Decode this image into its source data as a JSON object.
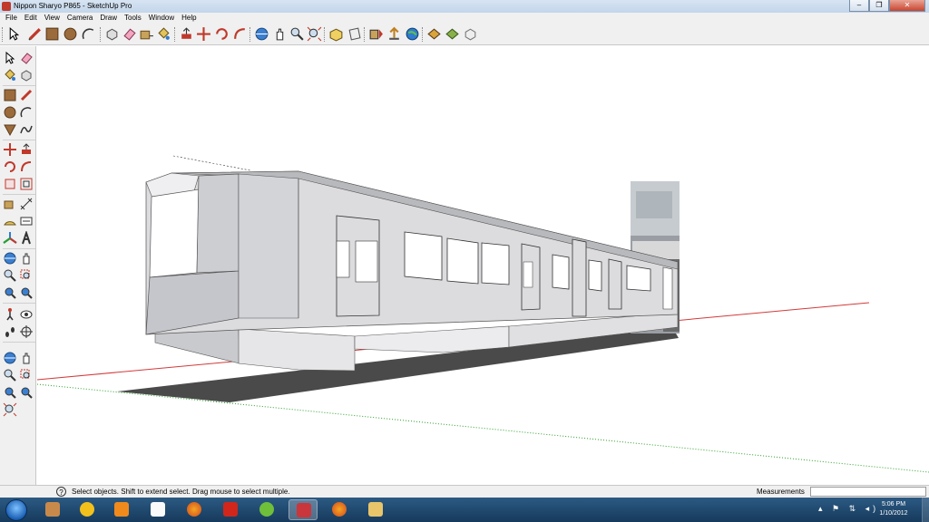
{
  "window": {
    "title": "Nippon Sharyo P865 - SketchUp Pro",
    "minimize_glyph": "–",
    "maximize_glyph": "❐",
    "close_glyph": "✕"
  },
  "menu": [
    "File",
    "Edit",
    "View",
    "Camera",
    "Draw",
    "Tools",
    "Window",
    "Help"
  ],
  "toolbar_icons": [
    "select-icon",
    "pencil-icon",
    "rectangle-icon",
    "circle-icon",
    "arc-icon",
    "make-component-icon",
    "eraser-icon",
    "paint-bucket-icon",
    "push-pull-icon",
    "move-icon",
    "rotate-icon",
    "follow-me-icon",
    "orbit-icon",
    "pan-icon",
    "zoom-icon",
    "zoom-extents-icon",
    "standard-views-icon",
    "section-plane-icon",
    "get-models-icon",
    "share-model-icon",
    "google-earth-icon",
    "component-icon",
    "warehouse-icon",
    "extension-icon"
  ],
  "left_icons": [
    "select-icon",
    "eraser-icon",
    "paint-bucket-icon",
    "make-component-icon",
    "rectangle-icon",
    "line-icon",
    "circle-icon",
    "arc-icon",
    "polygon-icon",
    "freehand-icon",
    "move-icon",
    "push-pull-icon",
    "rotate-icon",
    "follow-me-icon",
    "scale-icon",
    "offset-icon",
    "tape-measure-icon",
    "dimension-icon",
    "protractor-icon",
    "text-icon",
    "axes-icon",
    "3d-text-icon",
    "orbit-icon",
    "pan-icon",
    "zoom-icon",
    "zoom-window-icon",
    "zoom-extents-icon",
    "previous-view-icon",
    "position-camera-icon",
    "look-around-icon",
    "walk-icon",
    "section-plane-icon",
    "orbit-icon",
    "pan-icon",
    "zoom-icon",
    "zoom-window-icon",
    "zoom-extents-icon",
    "previous-view-icon",
    "zoom-extents-icon"
  ],
  "status": {
    "help_glyph": "?",
    "message": "Select objects. Shift to extend select. Drag mouse to select multiple.",
    "measurements_label": "Measurements",
    "measurements_value": ""
  },
  "taskbar": {
    "apps": [
      "tools-app-icon",
      "norton-icon",
      "media-player-icon",
      "blank-document-icon",
      "firefox-icon",
      "yahoo-icon",
      "spotify-icon",
      "sketchup-icon",
      "firefox-icon",
      "file-explorer-icon"
    ],
    "active_index": 7,
    "tray_glyphs": "▴ ⚑ ⇅ ◂)",
    "time": "5:06 PM",
    "date": "1/10/2012"
  },
  "colors": {
    "red_axis": "#d23a3a",
    "green_axis": "#2aa02a",
    "train_body": "#dcdcde",
    "train_shadow": "#4a4a4a"
  }
}
